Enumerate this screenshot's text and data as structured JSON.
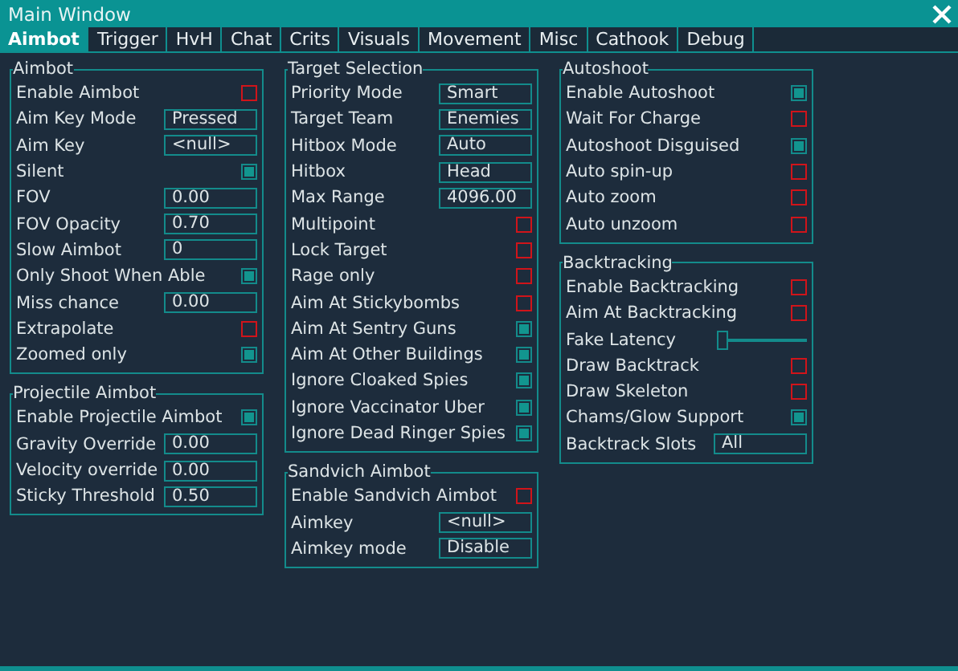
{
  "window": {
    "title": "Main Window"
  },
  "tabs": [
    {
      "label": "Aimbot",
      "selected": true
    },
    {
      "label": "Trigger",
      "selected": false
    },
    {
      "label": "HvH",
      "selected": false
    },
    {
      "label": "Chat",
      "selected": false
    },
    {
      "label": "Crits",
      "selected": false
    },
    {
      "label": "Visuals",
      "selected": false
    },
    {
      "label": "Movement",
      "selected": false
    },
    {
      "label": "Misc",
      "selected": false
    },
    {
      "label": "Cathook",
      "selected": false
    },
    {
      "label": "Debug",
      "selected": false
    }
  ],
  "columns": [
    {
      "groups": [
        {
          "title": "Aimbot",
          "rows": [
            {
              "kind": "checkbox",
              "label": "Enable Aimbot",
              "checked": false
            },
            {
              "kind": "field",
              "label": "Aim Key Mode",
              "value": "Pressed"
            },
            {
              "kind": "field",
              "label": "Aim Key",
              "value": "<null>"
            },
            {
              "kind": "checkbox",
              "label": "Silent",
              "checked": true
            },
            {
              "kind": "field",
              "label": "FOV",
              "value": "0.00"
            },
            {
              "kind": "field",
              "label": "FOV Opacity",
              "value": "0.70"
            },
            {
              "kind": "field",
              "label": "Slow Aimbot",
              "value": "0"
            },
            {
              "kind": "checkbox",
              "label": "Only Shoot When Able",
              "checked": true
            },
            {
              "kind": "field",
              "label": "Miss chance",
              "value": "0.00"
            },
            {
              "kind": "checkbox",
              "label": "Extrapolate",
              "checked": false
            },
            {
              "kind": "checkbox",
              "label": "Zoomed only",
              "checked": true
            }
          ]
        },
        {
          "title": "Projectile Aimbot",
          "rows": [
            {
              "kind": "checkbox",
              "label": "Enable Projectile Aimbot",
              "checked": true
            },
            {
              "kind": "field",
              "label": "Gravity Override",
              "value": "0.00"
            },
            {
              "kind": "field",
              "label": "Velocity override",
              "value": "0.00"
            },
            {
              "kind": "field",
              "label": "Sticky Threshold",
              "value": "0.50"
            }
          ]
        }
      ]
    },
    {
      "groups": [
        {
          "title": "Target Selection",
          "rows": [
            {
              "kind": "field",
              "label": "Priority Mode",
              "value": "Smart"
            },
            {
              "kind": "field",
              "label": "Target Team",
              "value": "Enemies"
            },
            {
              "kind": "field",
              "label": "Hitbox Mode",
              "value": "Auto"
            },
            {
              "kind": "field",
              "label": "Hitbox",
              "value": "Head"
            },
            {
              "kind": "field",
              "label": "Max Range",
              "value": "4096.00"
            },
            {
              "kind": "checkbox",
              "label": "Multipoint",
              "checked": false
            },
            {
              "kind": "checkbox",
              "label": "Lock Target",
              "checked": false
            },
            {
              "kind": "checkbox",
              "label": "Rage only",
              "checked": false
            },
            {
              "kind": "checkbox",
              "label": "Aim At Stickybombs",
              "checked": false
            },
            {
              "kind": "checkbox",
              "label": "Aim At Sentry Guns",
              "checked": true
            },
            {
              "kind": "checkbox",
              "label": "Aim At Other Buildings",
              "checked": true
            },
            {
              "kind": "checkbox",
              "label": "Ignore Cloaked Spies",
              "checked": true
            },
            {
              "kind": "checkbox",
              "label": "Ignore Vaccinator Uber",
              "checked": true
            },
            {
              "kind": "checkbox",
              "label": "Ignore Dead Ringer Spies",
              "checked": true
            }
          ]
        },
        {
          "title": "Sandvich Aimbot",
          "rows": [
            {
              "kind": "checkbox",
              "label": "Enable Sandvich Aimbot",
              "checked": false
            },
            {
              "kind": "field",
              "label": "Aimkey",
              "value": "<null>"
            },
            {
              "kind": "field",
              "label": "Aimkey mode",
              "value": "Disable"
            }
          ]
        }
      ]
    },
    {
      "groups": [
        {
          "title": "Autoshoot",
          "rows": [
            {
              "kind": "checkbox",
              "label": "Enable Autoshoot",
              "checked": true
            },
            {
              "kind": "checkbox",
              "label": "Wait For Charge",
              "checked": false
            },
            {
              "kind": "checkbox",
              "label": "Autoshoot Disguised",
              "checked": true
            },
            {
              "kind": "checkbox",
              "label": "Auto spin-up",
              "checked": false
            },
            {
              "kind": "checkbox",
              "label": "Auto zoom",
              "checked": false
            },
            {
              "kind": "checkbox",
              "label": "Auto unzoom",
              "checked": false
            }
          ]
        },
        {
          "title": "Backtracking",
          "rows": [
            {
              "kind": "checkbox",
              "label": "Enable Backtracking",
              "checked": false
            },
            {
              "kind": "checkbox",
              "label": "Aim At Backtracking",
              "checked": false
            },
            {
              "kind": "slider",
              "label": "Fake Latency",
              "level": 0
            },
            {
              "kind": "checkbox",
              "label": "Draw Backtrack",
              "checked": false
            },
            {
              "kind": "checkbox",
              "label": "Draw Skeleton",
              "checked": false
            },
            {
              "kind": "checkbox",
              "label": "Chams/Glow Support",
              "checked": true
            },
            {
              "kind": "field",
              "label": "Backtrack Slots",
              "value": "All"
            }
          ]
        }
      ]
    }
  ]
}
